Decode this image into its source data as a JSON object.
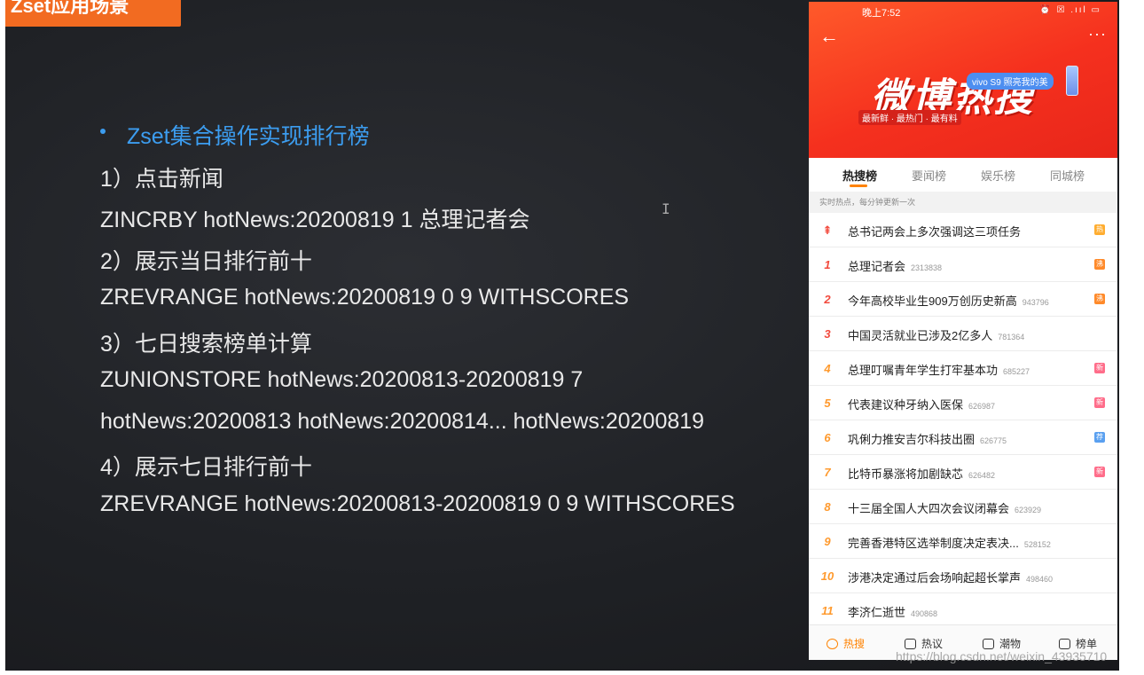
{
  "slide": {
    "tab_title": "Zset应用场景",
    "bullet": "Zset集合操作实现排行榜",
    "lines": [
      "1）点击新闻",
      "ZINCRBY  hotNews:20200819  1  总理记者会",
      "2）展示当日排行前十",
      "ZREVRANGE  hotNews:20200819  0  9  WITHSCORES",
      "3）七日搜索榜单计算",
      "ZUNIONSTORE  hotNews:20200813-20200819  7",
      "hotNews:20200813  hotNews:20200814... hotNews:20200819",
      "4）展示七日排行前十",
      "ZREVRANGE hotNews:20200813-20200819  0  9  WITHSCORES"
    ]
  },
  "phone": {
    "status_time": "晚上7:52",
    "status_icons": "⏰ ☒ .ııl ▭",
    "brand": "微博热搜",
    "brand_sub": "最新鲜 · 最热门 · 最有料",
    "vivo_badge": "vivo S9 照亮我的美",
    "tabs": [
      "热搜榜",
      "要闻榜",
      "娱乐榜",
      "同城榜"
    ],
    "tip": "实时热点，每分钟更新一次",
    "items": [
      {
        "rank": "⇞",
        "title": "总书记两会上多次强调这三项任务",
        "count": "",
        "badge": "热",
        "badge_color": "#ffad30",
        "rank_color": "#f24a3d"
      },
      {
        "rank": "1",
        "title": "总理记者会",
        "count": "2313838",
        "badge": "沸",
        "badge_color": "#ff8a2a",
        "rank_color": "#f24a3d"
      },
      {
        "rank": "2",
        "title": "今年高校毕业生909万创历史新高",
        "count": "943796",
        "badge": "沸",
        "badge_color": "#ff8a2a",
        "rank_color": "#f24a3d"
      },
      {
        "rank": "3",
        "title": "中国灵活就业已涉及2亿多人",
        "count": "781364",
        "badge": "",
        "badge_color": "",
        "rank_color": "#f24a3d"
      },
      {
        "rank": "4",
        "title": "总理叮嘱青年学生打牢基本功",
        "count": "685227",
        "badge": "新",
        "badge_color": "#ff6d8a",
        "rank_color": "#ff9a2e"
      },
      {
        "rank": "5",
        "title": "代表建议种牙纳入医保",
        "count": "626987",
        "badge": "新",
        "badge_color": "#ff6d8a",
        "rank_color": "#ff9a2e"
      },
      {
        "rank": "6",
        "title": "巩俐力推安吉尔科技出圈",
        "count": "626775",
        "badge": "荐",
        "badge_color": "#5aa0f0",
        "rank_color": "#ff9a2e"
      },
      {
        "rank": "7",
        "title": "比特币暴涨将加剧缺芯",
        "count": "626482",
        "badge": "新",
        "badge_color": "#ff6d8a",
        "rank_color": "#ff9a2e"
      },
      {
        "rank": "8",
        "title": "十三届全国人大四次会议闭幕会",
        "count": "623929",
        "badge": "",
        "badge_color": "",
        "rank_color": "#ff9a2e"
      },
      {
        "rank": "9",
        "title": "完善香港特区选举制度决定表决...",
        "count": "528152",
        "badge": "",
        "badge_color": "",
        "rank_color": "#ff9a2e"
      },
      {
        "rank": "10",
        "title": "涉港决定通过后会场响起超长掌声",
        "count": "498460",
        "badge": "",
        "badge_color": "",
        "rank_color": "#ff9a2e"
      },
      {
        "rank": "11",
        "title": "李济仁逝世",
        "count": "490868",
        "badge": "",
        "badge_color": "",
        "rank_color": "#ff9a2e"
      }
    ],
    "nav": [
      "热搜",
      "热议",
      "潮物",
      "榜单"
    ]
  },
  "watermark": "https://blog.csdn.net/weixin_43935710",
  "colors": {
    "accent_orange": "#f26b21",
    "bullet_blue": "#3c9df0",
    "weibo_red": "#f5301e"
  }
}
